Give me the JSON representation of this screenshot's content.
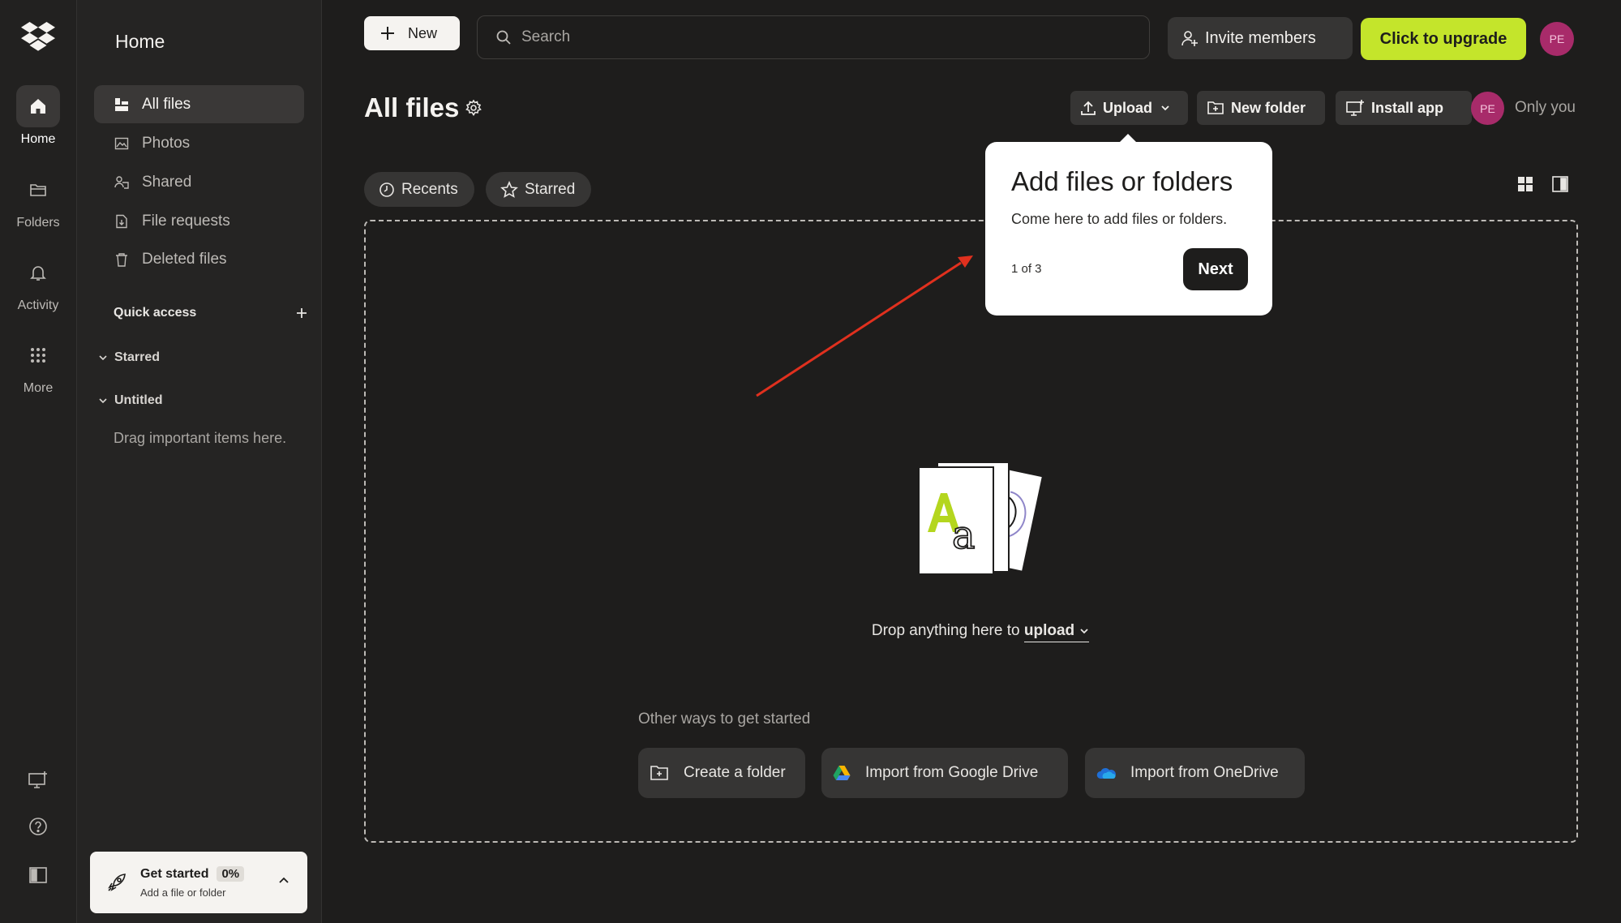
{
  "rail": {
    "items": [
      {
        "label": "Home",
        "icon": "home-icon"
      },
      {
        "label": "Folders",
        "icon": "folder-icon"
      },
      {
        "label": "Activity",
        "icon": "bell-icon"
      },
      {
        "label": "More",
        "icon": "grid-icon"
      }
    ],
    "bottom_icons": [
      "desktop-app-icon",
      "help-icon",
      "panel-toggle-icon"
    ]
  },
  "sidebar": {
    "title": "Home",
    "items": [
      {
        "label": "All files",
        "icon": "all-files-icon"
      },
      {
        "label": "Photos",
        "icon": "photos-icon"
      },
      {
        "label": "Shared",
        "icon": "shared-icon"
      },
      {
        "label": "File requests",
        "icon": "file-requests-icon"
      },
      {
        "label": "Deleted files",
        "icon": "trash-icon"
      }
    ],
    "quick_access": {
      "title": "Quick access",
      "groups": [
        "Starred",
        "Untitled"
      ],
      "empty_text": "Drag important items here."
    },
    "get_started": {
      "title": "Get started",
      "percent": "0%",
      "progress": 0,
      "subtitle": "Add a file or folder"
    }
  },
  "topbar": {
    "new_label": "New",
    "search_placeholder": "Search",
    "invite_label": "Invite members",
    "upgrade_label": "Click to upgrade",
    "avatar_initials": "PE"
  },
  "header": {
    "title": "All files",
    "upload_label": "Upload",
    "new_folder_label": "New folder",
    "install_app_label": "Install app",
    "avatar_initials": "PE",
    "sharing_label": "Only you"
  },
  "filters": {
    "recents_label": "Recents",
    "starred_label": "Starred"
  },
  "dropzone": {
    "text_prefix": "Drop anything here to",
    "upload_link": "upload",
    "other_ways": "Other ways to get started",
    "actions": [
      {
        "label": "Create a folder"
      },
      {
        "label": "Import from Google Drive"
      },
      {
        "label": "Import from OneDrive"
      }
    ]
  },
  "tooltip": {
    "title": "Add files or folders",
    "body": "Come here to add files or folders.",
    "step": "1 of 3",
    "next_label": "Next"
  },
  "colors": {
    "background": "#1e1d1c",
    "upgrade_accent": "#c4e52b",
    "avatar": "#a82b6a",
    "arrow": "#e0301e"
  }
}
